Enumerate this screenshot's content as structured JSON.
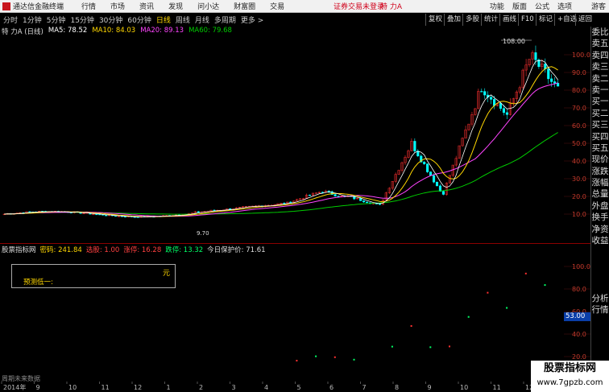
{
  "topbar": {
    "app_title": "通达信金融终端",
    "menus": [
      "行情",
      "市场",
      "资讯",
      "发现",
      "问小达",
      "财富圈",
      "交易"
    ],
    "warning": "证券交易未登录",
    "stock": "特 力A",
    "right": [
      "功能",
      "版面",
      "公式",
      "选项"
    ],
    "guest": "游客"
  },
  "periods": [
    "分时",
    "1分钟",
    "5分钟",
    "15分钟",
    "30分钟",
    "60分钟",
    "日线",
    "周线",
    "月线",
    "多周期",
    "更多 >"
  ],
  "active_period": "日线",
  "toolbar_buttons": [
    "复权",
    "叠加",
    "多股",
    "统计",
    "画线",
    "F10",
    "标记",
    "+自选",
    "返回"
  ],
  "info": {
    "name": "特 力A (日线)",
    "ma5": "MA5: 78.52",
    "ma10": "MA10: 84.03",
    "ma20": "MA20: 89.13",
    "ma60": "MA60: 79.68"
  },
  "colors": {
    "ma5": "#ffffff",
    "ma10": "#ffd700",
    "ma20": "#ff44ff",
    "ma60": "#00cc00",
    "up": "#ff3030",
    "down": "#00ffff"
  },
  "sidebar": [
    "委比",
    "卖五",
    "卖四",
    "卖三",
    "卖二",
    "卖一",
    "买一",
    "买二",
    "买三",
    "买四",
    "买五",
    "现价",
    "涨跌",
    "涨幅",
    "总量",
    "外盘",
    "换手",
    "净资",
    "收益",
    "",
    "",
    "",
    "",
    "分析",
    "行情"
  ],
  "price_axis": [
    "100.0",
    "90.0",
    "80.0",
    "70.0",
    "60.0",
    "50.0",
    "40.0",
    "30.0",
    "20.0",
    "10.0"
  ],
  "sub_axis": [
    "100.0",
    "80.0",
    "60.0",
    "40.0",
    "20.0"
  ],
  "high_label": "108.00",
  "low_label": "9.70",
  "sub_indicator": {
    "name": "股票指标网",
    "mima": "密码: 241.84",
    "xuan": "选股: 1.00",
    "zhangting": "涨停: 16.28",
    "dieting": "跌停: 13.32",
    "baohu": "今日保护价: 71.61"
  },
  "panel": {
    "yuan": "元",
    "text": "预测低一:"
  },
  "current_price": "53.00",
  "time_axis": [
    "2014年",
    "9",
    "10",
    "11",
    "12",
    "1",
    "2",
    "3",
    "4",
    "5",
    "6",
    "7",
    "8",
    "9",
    "10",
    "11",
    "12",
    "1"
  ],
  "bottom_left": "周期未来数据",
  "watermark": {
    "line1": "股票指标网",
    "line2": "www.7gpzb.com"
  }
}
